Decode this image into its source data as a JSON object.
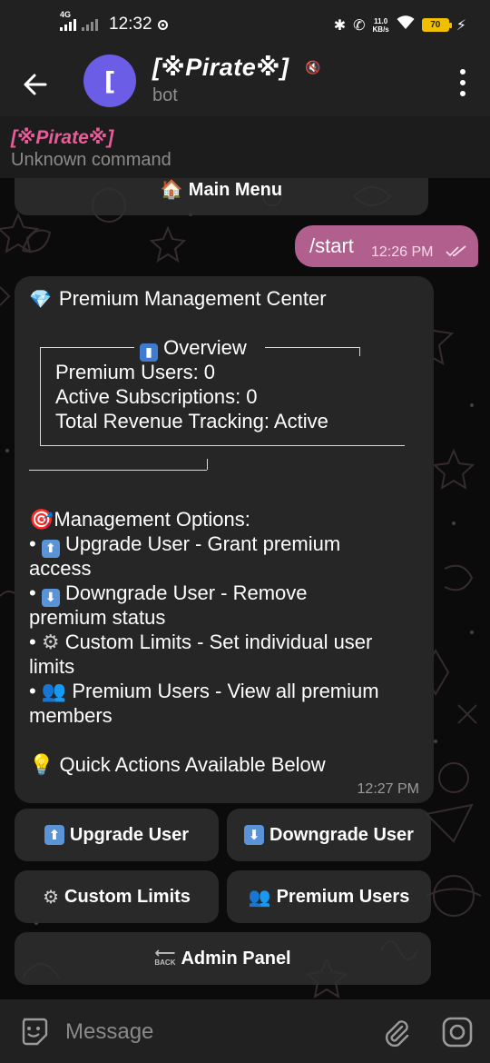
{
  "status_bar": {
    "network": "4G",
    "time": "12:32",
    "speed_value": "11.0",
    "speed_unit": "KB/s",
    "battery": "70"
  },
  "header": {
    "avatar_letter": "[",
    "title": "[※Pirate※]",
    "subtitle": "bot"
  },
  "reply_preview": {
    "name": "[※Pirate※]",
    "text": "Unknown command"
  },
  "keyboard_top": {
    "main_menu_icon": "🏠",
    "main_menu_label": "Main Menu"
  },
  "outgoing": {
    "text": "/start",
    "time": "12:26 PM"
  },
  "incoming": {
    "title": "Premium Management Center",
    "overview_label": "Overview",
    "stats": [
      "Premium Users: 0",
      "Active Subscriptions: 0",
      "Total Revenue Tracking: Active"
    ],
    "options_title": "Management Options:",
    "options": [
      {
        "line1": "Upgrade User - Grant premium",
        "line2": "access",
        "icon": "⬆"
      },
      {
        "line1": "Downgrade User - Remove",
        "line2": "premium status",
        "icon": "⬇"
      },
      {
        "line1": "Custom Limits - Set individual user",
        "line2": "limits",
        "icon": "⚙"
      },
      {
        "line1": "Premium Users - View all premium",
        "line2": "members",
        "icon": "👥"
      }
    ],
    "quick_actions": "Quick Actions Available Below",
    "time": "12:27 PM"
  },
  "buttons": {
    "upgrade": "Upgrade User",
    "downgrade": "Downgrade User",
    "custom_limits": "Custom Limits",
    "premium_users": "Premium Users",
    "admin_panel": "Admin Panel",
    "admin_icon_text": "BACK"
  },
  "input": {
    "placeholder": "Message"
  },
  "colors": {
    "header_bg": "#212121",
    "outgoing_bubble": "#b15f8c",
    "incoming_bubble": "#262626",
    "accent_pink": "#e95c9a",
    "avatar": "#6b5de6"
  }
}
